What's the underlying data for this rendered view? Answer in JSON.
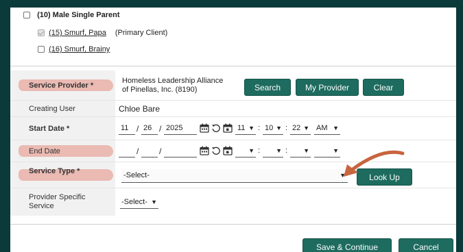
{
  "household": {
    "parent_label": "(10) Male Single Parent",
    "members": [
      {
        "name": "(15) Smurf, Papa",
        "note": "(Primary Client)",
        "checked": true
      },
      {
        "name": "(16) Smurf, Brainy",
        "note": "",
        "checked": false
      }
    ]
  },
  "form": {
    "service_provider": {
      "label": "Service Provider *",
      "value_line1": "Homeless Leadership Alliance",
      "value_line2": "of Pinellas, Inc. (8190)",
      "buttons": {
        "search": "Search",
        "my_provider": "My Provider",
        "clear": "Clear"
      }
    },
    "creating_user": {
      "label": "Creating User",
      "value": "Chloe Bare"
    },
    "start_date": {
      "label": "Start Date *",
      "month": "11",
      "day": "26",
      "year": "2025",
      "hour": "11",
      "minute": "10",
      "second": "22",
      "ampm": "AM"
    },
    "end_date": {
      "label": "End Date"
    },
    "service_type": {
      "label": "Service Type *",
      "selected": "-Select-",
      "lookup_button": "Look Up"
    },
    "provider_specific_service": {
      "label_line1": "Provider Specific",
      "label_line2": "Service",
      "selected": "-Select-"
    }
  },
  "footer": {
    "save_continue": "Save & Continue",
    "cancel": "Cancel"
  },
  "colors": {
    "button": "#1e6b5f",
    "annotation_arrow": "#c8643f",
    "label_highlight": "#e9b0a8",
    "frame": "#0b3a3a"
  },
  "icons": [
    "calendar-icon",
    "reset-icon",
    "calendar-today-icon",
    "chevron-down-icon",
    "arrow-annotation"
  ]
}
